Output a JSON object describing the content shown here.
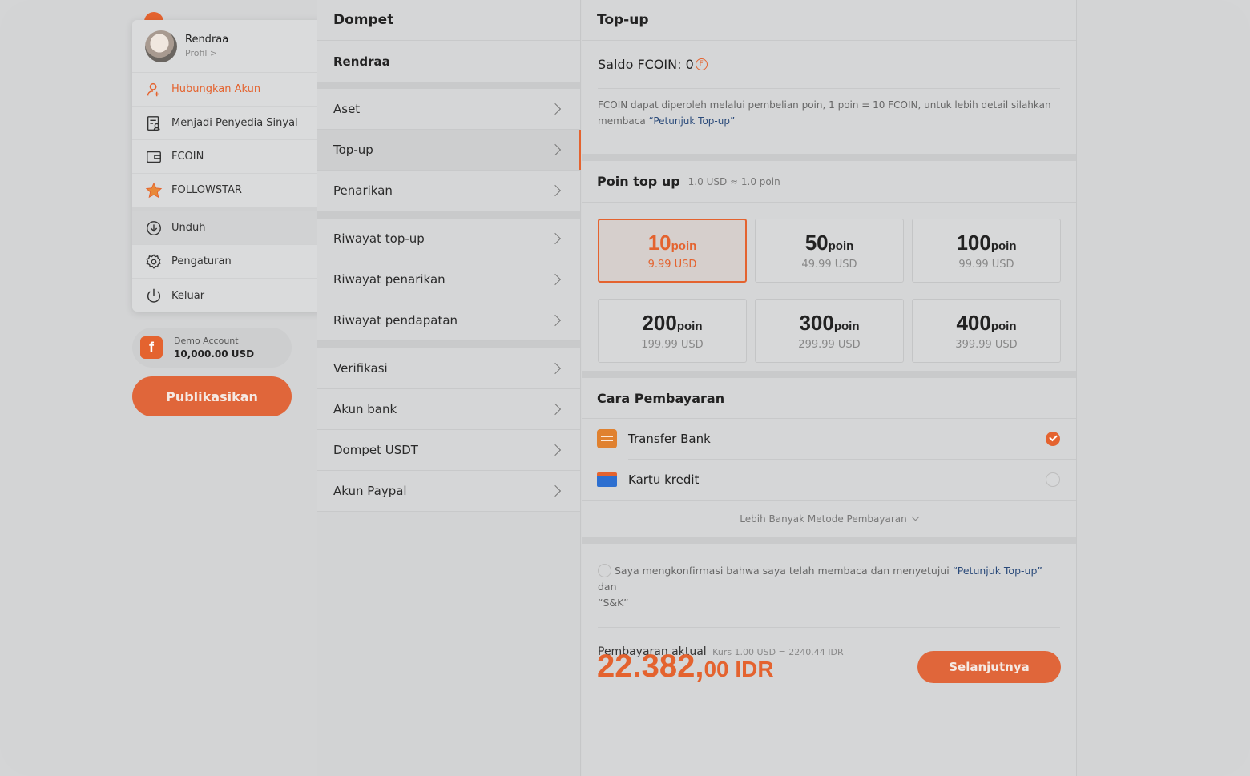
{
  "menu": {
    "profile_name": "Rendraa",
    "profile_sub": "Profil >",
    "items": [
      {
        "label": "Hubungkan Akun"
      },
      {
        "label": "Menjadi Penyedia Sinyal"
      },
      {
        "label": "FCOIN"
      },
      {
        "label": "FOLLOWSTAR"
      },
      {
        "label": "Unduh"
      },
      {
        "label": "Pengaturan"
      },
      {
        "label": "Keluar"
      }
    ]
  },
  "demo": {
    "logo": "f",
    "label": "Demo Account",
    "amount": "10,000.00 USD"
  },
  "publish_label": "Publikasikan",
  "wallet": {
    "title": "Dompet",
    "user": "Rendraa",
    "rows": [
      "Aset",
      "Top-up",
      "Penarikan",
      "Riwayat top-up",
      "Riwayat penarikan",
      "Riwayat pendapatan",
      "Verifikasi",
      "Akun bank",
      "Dompet USDT",
      "Akun Paypal"
    ],
    "active": "Top-up"
  },
  "topup": {
    "title": "Top-up",
    "balance_label": "Saldo FCOIN: 0",
    "coin_glyph": "F",
    "desc_text": "FCOIN dapat diperoleh melalui pembelian poin, 1 poin = 10 FCOIN, untuk lebih detail silahkan membaca ",
    "desc_link": "“Petunjuk Top-up”",
    "points_title": "Poin top up",
    "points_note": "1.0 USD ≈ 1.0 poin",
    "packages": [
      {
        "amount": "10",
        "unit": "poin",
        "price": "9.99  USD",
        "selected": true
      },
      {
        "amount": "50",
        "unit": "poin",
        "price": "49.99  USD",
        "selected": false
      },
      {
        "amount": "100",
        "unit": "poin",
        "price": "99.99  USD",
        "selected": false
      },
      {
        "amount": "200",
        "unit": "poin",
        "price": "199.99  USD",
        "selected": false
      },
      {
        "amount": "300",
        "unit": "poin",
        "price": "299.99  USD",
        "selected": false
      },
      {
        "amount": "400",
        "unit": "poin",
        "price": "399.99  USD",
        "selected": false
      }
    ],
    "payment_title": "Cara Pembayaran",
    "payment_methods": [
      {
        "label": "Transfer Bank",
        "selected": true
      },
      {
        "label": "Kartu kredit",
        "selected": false
      }
    ],
    "more_methods": "Lebih Banyak Metode Pembayaran",
    "agree_text": "Saya mengkonfirmasi bahwa saya telah membaca dan menyetujui ",
    "agree_link": "“Petunjuk Top-up”",
    "agree_and": " dan",
    "agree_tc": "“S&K”",
    "actual_label": "Pembayaran aktual",
    "rate": "Kurs 1.00 USD = 2240.44 IDR",
    "total_main": "22.382,",
    "total_sub": "00 IDR",
    "next_label": "Selanjutnya"
  },
  "colors": {
    "accent": "#e4632f",
    "link": "#2a4a7a"
  }
}
